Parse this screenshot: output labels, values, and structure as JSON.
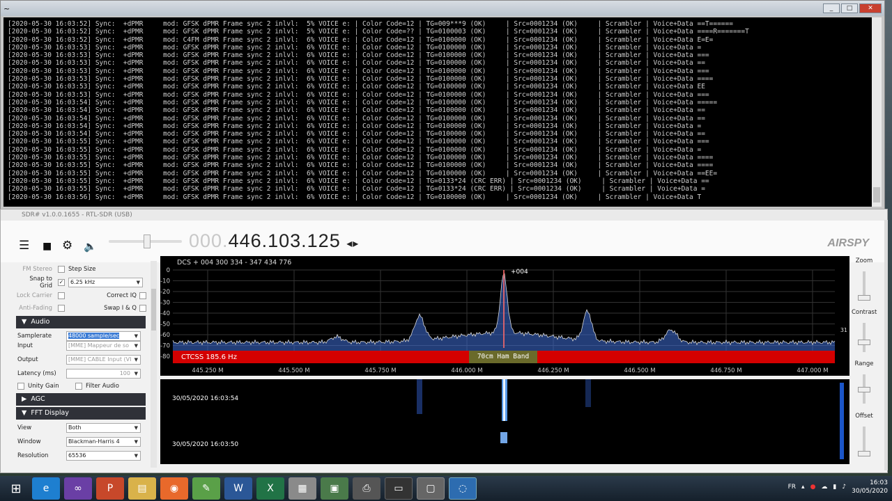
{
  "console": {
    "title": "~",
    "minimize": "_",
    "maximize": "□",
    "close": "✕",
    "lines": [
      "[2020-05-30 16:03:52] Sync:  +dPMR     mod: GFSK dPMR Frame sync 2 inlvl:  5% VOICE e: | Color Code=12 | TG=009***9 (OK)     | Src=0001234 (OK)     | Scrambler | Voice+Data ==T======",
      "[2020-05-30 16:03:52] Sync:  +dPMR     mod: GFSK dPMR Frame sync 2 inlvl:  5% VOICE e: | Color Code=?? | TG=0100003 (OK)     | Src=0001234 (OK)     | Scrambler | Voice+Data ====R=======T",
      "[2020-05-30 16:03:52] Sync:  +dPMR     mod: C4FM dPMR Frame sync 2 inlvl:  6% VOICE e: | Color Code=12 | TG=0100000 (OK)     | Src=0001234 (OK)     | Scrambler | Voice+Data E=E=",
      "[2020-05-30 16:03:53] Sync:  +dPMR     mod: GFSK dPMR Frame sync 2 inlvl:  6% VOICE e: | Color Code=12 | TG=0100000 (OK)     | Src=0001234 (OK)     | Scrambler | Voice+Data =",
      "[2020-05-30 16:03:53] Sync:  +dPMR     mod: GFSK dPMR Frame sync 2 inlvl:  6% VOICE e: | Color Code=12 | TG=0100000 (OK)     | Src=0001234 (OK)     | Scrambler | Voice+Data ===",
      "[2020-05-30 16:03:53] Sync:  +dPMR     mod: GFSK dPMR Frame sync 2 inlvl:  6% VOICE e: | Color Code=12 | TG=0100000 (OK)     | Src=0001234 (OK)     | Scrambler | Voice+Data ==",
      "[2020-05-30 16:03:53] Sync:  +dPMR     mod: GFSK dPMR Frame sync 2 inlvl:  6% VOICE e: | Color Code=12 | TG=0100000 (OK)     | Src=0001234 (OK)     | Scrambler | Voice+Data ===",
      "[2020-05-30 16:03:53] Sync:  +dPMR     mod: GFSK dPMR Frame sync 2 inlvl:  6% VOICE e: | Color Code=12 | TG=0100000 (OK)     | Src=0001234 (OK)     | Scrambler | Voice+Data ====",
      "[2020-05-30 16:03:53] Sync:  +dPMR     mod: GFSK dPMR Frame sync 2 inlvl:  6% VOICE e: | Color Code=12 | TG=0100000 (OK)     | Src=0001234 (OK)     | Scrambler | Voice+Data EE",
      "[2020-05-30 16:03:53] Sync:  +dPMR     mod: GFSK dPMR Frame sync 2 inlvl:  6% VOICE e: | Color Code=12 | TG=0100000 (OK)     | Src=0001234 (OK)     | Scrambler | Voice+Data ===",
      "[2020-05-30 16:03:54] Sync:  +dPMR     mod: GFSK dPMR Frame sync 2 inlvl:  6% VOICE e: | Color Code=12 | TG=0100000 (OK)     | Src=0001234 (OK)     | Scrambler | Voice+Data =====",
      "[2020-05-30 16:03:54] Sync:  +dPMR     mod: GFSK dPMR Frame sync 2 inlvl:  6% VOICE e: | Color Code=12 | TG=0100000 (OK)     | Src=0001234 (OK)     | Scrambler | Voice+Data ==",
      "[2020-05-30 16:03:54] Sync:  +dPMR     mod: GFSK dPMR Frame sync 2 inlvl:  6% VOICE e: | Color Code=12 | TG=0100000 (OK)     | Src=0001234 (OK)     | Scrambler | Voice+Data ==",
      "[2020-05-30 16:03:54] Sync:  +dPMR     mod: GFSK dPMR Frame sync 2 inlvl:  6% VOICE e: | Color Code=12 | TG=0100000 (OK)     | Src=0001234 (OK)     | Scrambler | Voice+Data =",
      "[2020-05-30 16:03:54] Sync:  +dPMR     mod: GFSK dPMR Frame sync 2 inlvl:  6% VOICE e: | Color Code=12 | TG=0100000 (OK)     | Src=0001234 (OK)     | Scrambler | Voice+Data ==",
      "[2020-05-30 16:03:55] Sync:  +dPMR     mod: GFSK dPMR Frame sync 2 inlvl:  6% VOICE e: | Color Code=12 | TG=0100000 (OK)     | Src=0001234 (OK)     | Scrambler | Voice+Data ===",
      "[2020-05-30 16:03:55] Sync:  +dPMR     mod: GFSK dPMR Frame sync 2 inlvl:  6% VOICE e: | Color Code=12 | TG=0100000 (OK)     | Src=0001234 (OK)     | Scrambler | Voice+Data =",
      "[2020-05-30 16:03:55] Sync:  +dPMR     mod: GFSK dPMR Frame sync 2 inlvl:  6% VOICE e: | Color Code=12 | TG=0100000 (OK)     | Src=0001234 (OK)     | Scrambler | Voice+Data ====",
      "[2020-05-30 16:03:55] Sync:  +dPMR     mod: GFSK dPMR Frame sync 2 inlvl:  6% VOICE e: | Color Code=12 | TG=0100000 (OK)     | Src=0001234 (OK)     | Scrambler | Voice+Data ====",
      "[2020-05-30 16:03:55] Sync:  +dPMR     mod: GFSK dPMR Frame sync 2 inlvl:  6% VOICE e: | Color Code=12 | TG=0100000 (OK)     | Src=0001234 (OK)     | Scrambler | Voice+Data ==EE=",
      "[2020-05-30 16:03:55] Sync:  +dPMR     mod: GFSK dPMR Frame sync 2 inlvl:  6% VOICE e: | Color Code=12 | TG=0133*24 (CRC ERR) | Src=0001234 (OK)     | Scrambler | Voice+Data ==",
      "[2020-05-30 16:03:55] Sync:  +dPMR     mod: GFSK dPMR Frame sync 2 inlvl:  6% VOICE e: | Color Code=12 | TG=0133*24 (CRC ERR) | Src=0001234 (OK)     | Scrambler | Voice+Data =",
      "[2020-05-30 16:03:56] Sync:  +dPMR     mod: GFSK dPMR Frame sync 2 inlvl:  6% VOICE e: | Color Code=12 | TG=0100000 (OK)     | Src=0001234 (OK)     | Scrambler | Voice+Data T"
    ]
  },
  "sdr": {
    "title": "SDR# v1.0.0.1655 - RTL-SDR (USB)",
    "freq_dim": "000.",
    "freq_main": "446.103.125",
    "freq_arrows": "◂▸",
    "logo": "AIRSPY"
  },
  "left": {
    "fm_stereo": "FM Stereo",
    "step_size": "Step Size",
    "snap": "Snap to Grid",
    "snap_check": "✓",
    "snap_value": "6.25 kHz",
    "lock_carrier": "Lock Carrier",
    "correct_iq": "Correct IQ",
    "anti_fading": "Anti-Fading",
    "swap_iq": "Swap I & Q",
    "audio_section": "Audio",
    "samplerate": "Samplerate",
    "samplerate_value": "48000 sample/sec",
    "input": "Input",
    "input_value": "[MME] Mappeur de so",
    "output": "Output",
    "output_value": "[MME] CABLE Input (VI",
    "latency": "Latency (ms)",
    "latency_value": "100",
    "unity_gain": "Unity Gain",
    "filter_audio": "Filter Audio",
    "agc_section": "AGC",
    "fft_section": "FFT Display",
    "view": "View",
    "view_value": "Both",
    "window": "Window",
    "window_value": "Blackman-Harris 4",
    "resolution": "Resolution",
    "resolution_value": "65536",
    "expanded_arrow": "▼",
    "collapsed_arrow": "▶"
  },
  "spectrum": {
    "header": "DCS + 004 300 334  - 347 434 776",
    "marker": "+004",
    "ctcss": "CTCSS  185.6 Hz",
    "band": "70cm Ham Band",
    "right_value": "31",
    "y_ticks": [
      "0",
      "-10",
      "-20",
      "-30",
      "-40",
      "-50",
      "-60",
      "-70",
      "-80"
    ],
    "x_ticks": [
      "445.250 M",
      "445.500 M",
      "445.750 M",
      "446.000 M",
      "446.250 M",
      "446.500 M",
      "446.750 M",
      "447.000 M"
    ],
    "colors": {
      "band": "#d40000",
      "trace": "#3f6fd8",
      "peak": "#ff6a6a"
    }
  },
  "waterfall": {
    "time1": "30/05/2020 16:03:54",
    "time2": "30/05/2020 16:03:50"
  },
  "right": {
    "zoom": "Zoom",
    "contrast": "Contrast",
    "range": "Range",
    "offset": "Offset"
  },
  "taskbar": {
    "lang": "FR",
    "time": "16:03",
    "date": "30/05/2020"
  }
}
